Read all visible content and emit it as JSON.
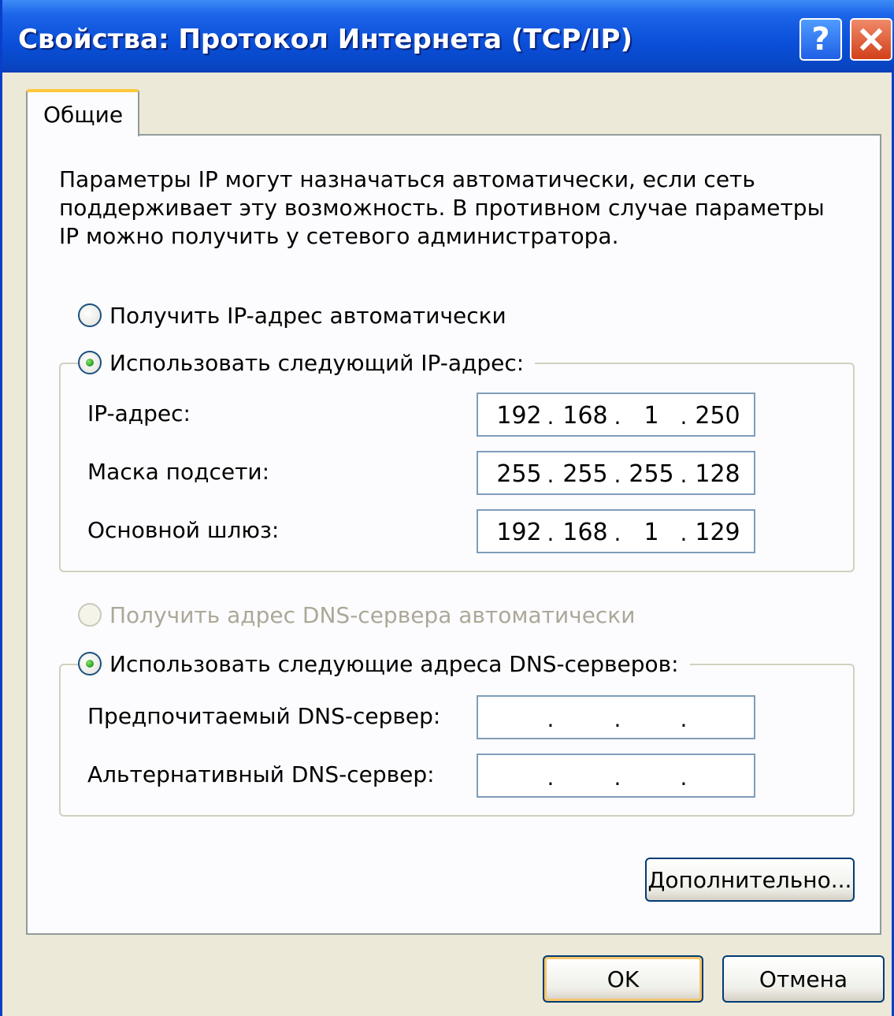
{
  "window": {
    "title": "Свойства: Протокол Интернета (TCP/IP)",
    "help_label": "?",
    "colors": {
      "titlebar": "#0a4fd8",
      "body": "#ece9d8",
      "panel": "#fcfcfe",
      "close": "#d2401a"
    }
  },
  "tabs": [
    {
      "label": "Общие",
      "selected": true
    }
  ],
  "description": "Параметры IP могут назначаться автоматически, если сеть поддерживает эту возможность. В противном случае параметры IP можно получить у сетевого администратора.",
  "ip_mode": {
    "auto_label": "Получить IP-адрес автоматически",
    "auto_selected": false,
    "manual_label": "Использовать следующий IP-адрес:",
    "manual_selected": true
  },
  "ip_fields": {
    "ip": {
      "label": "IP-адрес:",
      "octets": [
        "192",
        "168",
        "1",
        "250"
      ]
    },
    "mask": {
      "label": "Маска подсети:",
      "octets": [
        "255",
        "255",
        "255",
        "128"
      ]
    },
    "gateway": {
      "label": "Основной шлюз:",
      "octets": [
        "192",
        "168",
        "1",
        "129"
      ]
    }
  },
  "dns_mode": {
    "auto_label": "Получить адрес DNS-сервера автоматически",
    "auto_selected": false,
    "auto_disabled": true,
    "manual_label": "Использовать следующие адреса DNS-серверов:",
    "manual_selected": true
  },
  "dns_fields": {
    "preferred": {
      "label": "Предпочитаемый DNS-сервер:",
      "octets": [
        "",
        "",
        "",
        ""
      ]
    },
    "alternate": {
      "label": "Альтернативный DNS-сервер:",
      "octets": [
        "",
        "",
        "",
        ""
      ]
    }
  },
  "buttons": {
    "advanced": "Дополнительно...",
    "ok": "OK",
    "cancel": "Отмена"
  }
}
